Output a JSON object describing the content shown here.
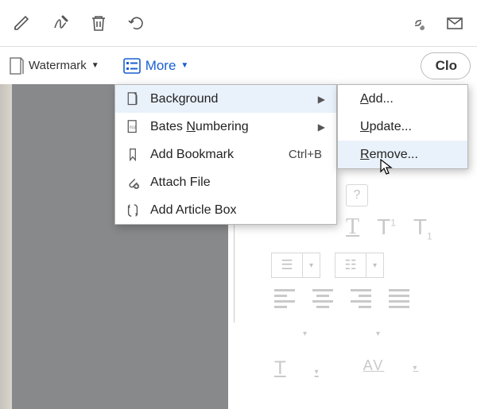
{
  "topbar": {
    "icons": {
      "pencil": "pencil-icon",
      "sign": "sign-icon",
      "trash": "trash-icon",
      "rotate": "rotate-icon",
      "link": "link-cloud-icon",
      "envelope": "envelope-icon"
    }
  },
  "secbar": {
    "watermark_label": "Watermark",
    "more_label": "More",
    "close_label": "Clo"
  },
  "more_menu": {
    "items": [
      {
        "label": "Background",
        "has_submenu": true,
        "hover": true,
        "icon": "page-icon"
      },
      {
        "label_pre": "Bates ",
        "label_u": "N",
        "label_post": "umbering",
        "has_submenu": true,
        "icon": "bates-icon"
      },
      {
        "label": "Add Bookmark",
        "shortcut": "Ctrl+B",
        "icon": "bookmark-icon"
      },
      {
        "label": "Attach File",
        "icon": "attach-icon"
      },
      {
        "label": "Add Article Box",
        "icon": "article-icon"
      }
    ]
  },
  "sub_menu": {
    "items": [
      {
        "label_u": "A",
        "label_post": "dd..."
      },
      {
        "label_u": "U",
        "label_post": "pdate..."
      },
      {
        "label_u": "R",
        "label_post": "emove...",
        "hover": true
      }
    ]
  },
  "rpanel": {
    "help": "?",
    "t1": "T",
    "t2": "T",
    "t3": "T",
    "listmarks": "≡",
    "numlist": "≡",
    "bigT": "T",
    "av": "AV"
  }
}
